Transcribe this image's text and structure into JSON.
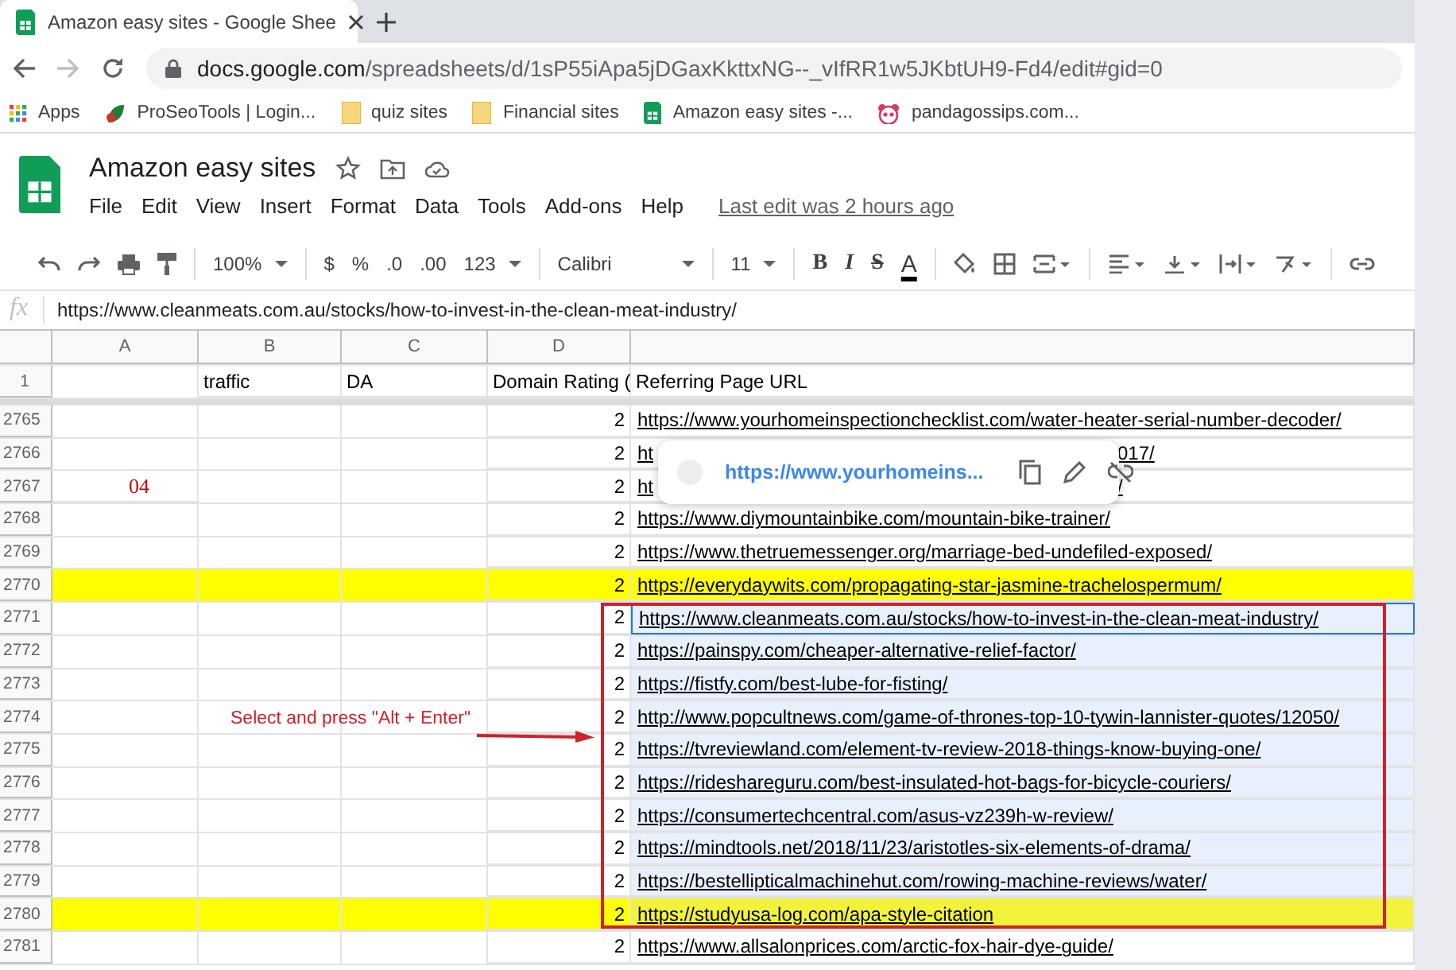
{
  "browser": {
    "tab": {
      "title": "Amazon easy sites - Google Shee"
    },
    "address": {
      "host": "docs.google.com",
      "path": "/spreadsheets/d/1sP55iApa5jDGaxKkttxNG--_vIfRR1w5JKbtUH9-Fd4/edit#gid=0"
    },
    "bookmarks": [
      {
        "label": "Apps",
        "kind": "apps"
      },
      {
        "label": "ProSeoTools | Login...",
        "kind": "site"
      },
      {
        "label": "quiz sites",
        "kind": "folder"
      },
      {
        "label": "Financial sites",
        "kind": "folder"
      },
      {
        "label": "Amazon easy sites -...",
        "kind": "sheets"
      },
      {
        "label": "pandagossips.com...",
        "kind": "panda"
      }
    ]
  },
  "document": {
    "title": "Amazon easy sites",
    "menu": [
      "File",
      "Edit",
      "View",
      "Insert",
      "Format",
      "Data",
      "Tools",
      "Add-ons",
      "Help"
    ],
    "last_edit": "Last edit was 2 hours ago"
  },
  "toolbar": {
    "zoom": "100%",
    "currency": "$",
    "percent": "%",
    "decrease_decimals": ".0",
    "increase_decimals": ".00",
    "more_formats": "123",
    "font": "Calibri",
    "font_size": "11",
    "bold": "B",
    "italic": "I",
    "strikethrough": "S",
    "text_color": "A"
  },
  "formula_bar": {
    "label": "fx",
    "value": "https://www.cleanmeats.com.au/stocks/how-to-invest-in-the-clean-meat-industry/"
  },
  "grid": {
    "columns": [
      "A",
      "B",
      "C",
      "D"
    ],
    "header_row": {
      "number": "1",
      "b": "traffic",
      "c": "DA",
      "d": "Domain Rating (",
      "e": "Referring Page URL"
    },
    "rows": [
      {
        "number": "2765",
        "d": "2",
        "e": "https://www.yourhomeinspectionchecklist.com/water-heater-serial-number-decoder/",
        "highlighted": false,
        "selected": false,
        "active": false
      },
      {
        "number": "2766",
        "d": "2",
        "e": "ht",
        "e_tail": "017/",
        "highlighted": false,
        "selected": false,
        "active": false
      },
      {
        "number": "2767",
        "a": "04",
        "d": "2",
        "e": "ht",
        "e_tail": "/",
        "highlighted": false,
        "selected": false,
        "active": false
      },
      {
        "number": "2768",
        "d": "2",
        "e": "https://www.diymountainbike.com/mountain-bike-trainer/",
        "highlighted": false,
        "selected": false,
        "active": false
      },
      {
        "number": "2769",
        "d": "2",
        "e": "https://www.thetruemessenger.org/marriage-bed-undefiled-exposed/",
        "highlighted": false,
        "selected": false,
        "active": false
      },
      {
        "number": "2770",
        "d": "2",
        "e": "https://everydaywits.com/propagating-star-jasmine-trachelospermum/",
        "highlighted": true,
        "selected": false,
        "active": false
      },
      {
        "number": "2771",
        "d": "2",
        "e": "https://www.cleanmeats.com.au/stocks/how-to-invest-in-the-clean-meat-industry/",
        "highlighted": false,
        "selected": true,
        "active": true
      },
      {
        "number": "2772",
        "d": "2",
        "e": "https://painspy.com/cheaper-alternative-relief-factor/",
        "highlighted": false,
        "selected": true,
        "active": false
      },
      {
        "number": "2773",
        "d": "2",
        "e": "https://fistfy.com/best-lube-for-fisting/",
        "highlighted": false,
        "selected": true,
        "active": false
      },
      {
        "number": "2774",
        "d": "2",
        "e": "http://www.popcultnews.com/game-of-thrones-top-10-tywin-lannister-quotes/12050/",
        "highlighted": false,
        "selected": true,
        "active": false
      },
      {
        "number": "2775",
        "d": "2",
        "e": "https://tvreviewland.com/element-tv-review-2018-things-know-buying-one/",
        "highlighted": false,
        "selected": true,
        "active": false
      },
      {
        "number": "2776",
        "d": "2",
        "e": "https://rideshareguru.com/best-insulated-hot-bags-for-bicycle-couriers/",
        "highlighted": false,
        "selected": true,
        "active": false
      },
      {
        "number": "2777",
        "d": "2",
        "e": "https://consumertechcentral.com/asus-vz239h-w-review/",
        "highlighted": false,
        "selected": true,
        "active": false
      },
      {
        "number": "2778",
        "d": "2",
        "e": "https://mindtools.net/2018/11/23/aristotles-six-elements-of-drama/",
        "highlighted": false,
        "selected": true,
        "active": false
      },
      {
        "number": "2779",
        "d": "2",
        "e": "https://bestellipticalmachinehut.com/rowing-machine-reviews/water/",
        "highlighted": false,
        "selected": true,
        "active": false
      },
      {
        "number": "2780",
        "d": "2",
        "e": "https://studyusa-log.com/apa-style-citation",
        "highlighted": true,
        "selected": true,
        "active": false
      },
      {
        "number": "2781",
        "d": "2",
        "e": "https://www.allsalonprices.com/arctic-fox-hair-dye-guide/",
        "highlighted": false,
        "selected": false,
        "active": false
      }
    ]
  },
  "link_popup": {
    "url": "https://www.yourhomeins..."
  },
  "annotation": {
    "text": "Select and press \"Alt + Enter\""
  }
}
